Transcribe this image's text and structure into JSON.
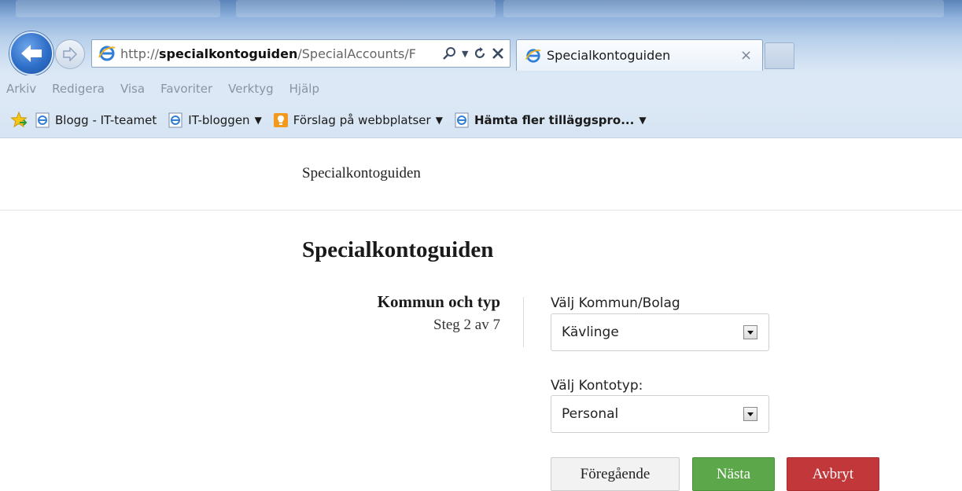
{
  "browser": {
    "address_url_bold": "specialkontoguiden",
    "address_url_prefix": "http://",
    "address_url_rest": "/SpecialAccounts/F",
    "tab_title": "Specialkontoguiden",
    "menu": [
      "Arkiv",
      "Redigera",
      "Visa",
      "Favoriter",
      "Verktyg",
      "Hjälp"
    ],
    "favorites": [
      {
        "label": "Blogg - IT-teamet",
        "icon": "ie-page-icon",
        "dropdown": false,
        "bold": false
      },
      {
        "label": "IT-bloggen",
        "icon": "ie-page-icon",
        "dropdown": true,
        "bold": false
      },
      {
        "label": "Förslag på webbplatser",
        "icon": "suggested-sites-icon",
        "dropdown": true,
        "bold": false
      },
      {
        "label": "Hämta fler tilläggspro...",
        "icon": "ie-page-icon",
        "dropdown": true,
        "bold": true
      }
    ]
  },
  "site": {
    "brand": "Specialkontoguiden"
  },
  "page": {
    "title": "Specialkontoguiden",
    "step_title": "Kommun och typ",
    "step_sub": "Steg 2 av 7"
  },
  "form": {
    "kommun_label": "Välj Kommun/Bolag",
    "kommun_value": "Kävlinge",
    "kontotyp_label": "Välj Kontotyp:",
    "kontotyp_value": "Personal"
  },
  "buttons": {
    "prev": "Föregående",
    "next": "Nästa",
    "cancel": "Avbryt"
  },
  "colors": {
    "next_button": "#5ba749",
    "cancel_button": "#c2383a",
    "chrome_blue": "#dce8f5"
  }
}
